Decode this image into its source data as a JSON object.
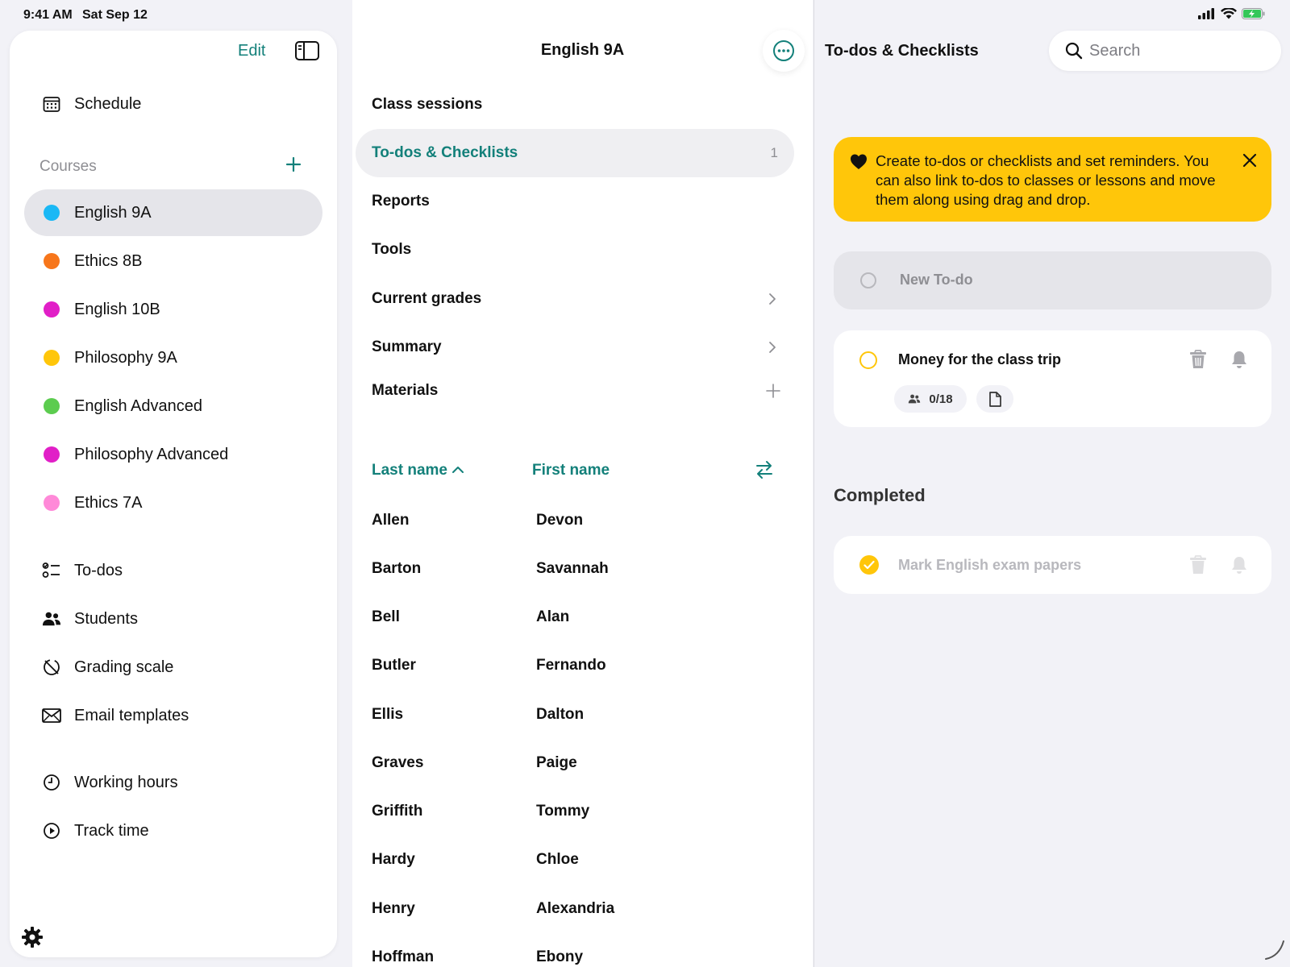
{
  "status_bar": {
    "time": "9:41 AM",
    "date": "Sat Sep 12"
  },
  "sidebar": {
    "edit_label": "Edit",
    "schedule_label": "Schedule",
    "courses_title": "Courses",
    "courses": [
      {
        "label": "English 9A",
        "color": "#1ab8f5",
        "active": true
      },
      {
        "label": "Ethics 8B",
        "color": "#f7761b"
      },
      {
        "label": "English 10B",
        "color": "#e11fc7"
      },
      {
        "label": "Philosophy 9A",
        "color": "#ffc60a"
      },
      {
        "label": "English Advanced",
        "color": "#5ccc4f"
      },
      {
        "label": "Philosophy Advanced",
        "color": "#e11fc7"
      },
      {
        "label": "Ethics 7A",
        "color": "#ff89d8"
      }
    ],
    "tools": [
      {
        "label": "To-dos",
        "icon": "todos-icon"
      },
      {
        "label": "Students",
        "icon": "students-icon"
      },
      {
        "label": "Grading scale",
        "icon": "grading-scale-icon"
      },
      {
        "label": "Email templates",
        "icon": "envelope-icon"
      }
    ],
    "time": [
      {
        "label": "Working hours",
        "icon": "clock-icon"
      },
      {
        "label": "Track time",
        "icon": "play-circle-icon"
      }
    ]
  },
  "middle": {
    "title": "English 9A",
    "menu": [
      {
        "label": "Class sessions"
      },
      {
        "label": "To-dos & Checklists",
        "count": "1",
        "active": true
      },
      {
        "label": "Reports"
      },
      {
        "label": "Tools"
      },
      {
        "label": "Current grades",
        "chevron": true
      },
      {
        "label": "Summary",
        "chevron": true
      },
      {
        "label": "Materials",
        "plus": true
      }
    ],
    "columns": {
      "last": "Last name",
      "first": "First name"
    },
    "students": [
      {
        "last": "Allen",
        "first": "Devon"
      },
      {
        "last": "Barton",
        "first": "Savannah"
      },
      {
        "last": "Bell",
        "first": "Alan"
      },
      {
        "last": "Butler",
        "first": "Fernando"
      },
      {
        "last": "Ellis",
        "first": "Dalton"
      },
      {
        "last": "Graves",
        "first": "Paige"
      },
      {
        "last": "Griffith",
        "first": "Tommy"
      },
      {
        "last": "Hardy",
        "first": "Chloe"
      },
      {
        "last": "Henry",
        "first": "Alexandria"
      },
      {
        "last": "Hoffman",
        "first": "Ebony"
      }
    ]
  },
  "right": {
    "title": "To-dos & Checklists",
    "search_placeholder": "Search",
    "banner_text": "Create to-dos or checklists and set reminders. You can also link to-dos to classes or lessons and move them along using drag and drop.",
    "new_todo_label": "New To-do",
    "todo": {
      "title": "Money for the class trip",
      "students_count": "0/18"
    },
    "completed_title": "Completed",
    "completed_todo": {
      "title": "Mark English exam papers"
    }
  },
  "colors": {
    "accent": "#13807a",
    "banner": "#ffc60a"
  }
}
